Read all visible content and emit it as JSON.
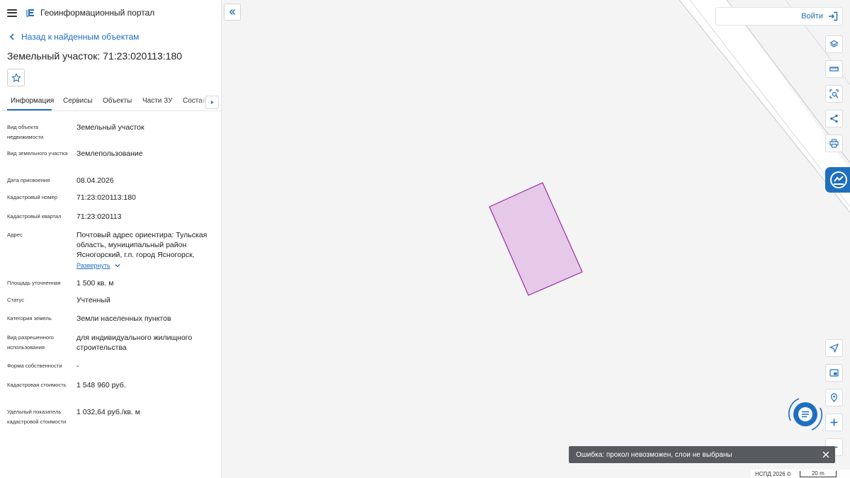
{
  "app": {
    "title": "Геоинформационный портал"
  },
  "nav": {
    "back_label": "Назад к найденным объектам"
  },
  "object": {
    "title": "Земельный участок: 71:23:020113:180"
  },
  "tabs": [
    {
      "label": "Информация"
    },
    {
      "label": "Сервисы"
    },
    {
      "label": "Объекты"
    },
    {
      "label": "Части ЗУ"
    },
    {
      "label": "Состав"
    }
  ],
  "fields": [
    {
      "label": "Вид объекта недвижимости",
      "value": "Земельный участок"
    },
    {
      "label": "Вид земельного участка",
      "value": "Землепользование"
    },
    {
      "label": "Дата присвоения",
      "value": "08.04.2026"
    },
    {
      "label": "Кадастровый номер",
      "value": "71:23:020113:180"
    },
    {
      "label": "Кадастровый квартал",
      "value": "71:23:020113"
    },
    {
      "label": "Адрес",
      "value": "Почтовый адрес ориентира: Тульская область, муниципальный район Ясногорский, г.п. город Ясногорск,",
      "expand_label": "Развернуть"
    },
    {
      "label": "Площадь уточненная",
      "value": "1 500 кв. м"
    },
    {
      "label": "Статус",
      "value": "Учтенный"
    },
    {
      "label": "Категория земель",
      "value": "Земли населенных пунктов"
    },
    {
      "label": "Вид разрешенного использования",
      "value": "для индивидуального жилищного строительства"
    },
    {
      "label": "Форма собственности",
      "value": "-"
    },
    {
      "label": "Кадастровая стоимость",
      "value": "1 548 960 руб."
    },
    {
      "label": "Удельный показатель кадастровой стоимости",
      "value": "1 032,64 руб./кв. м"
    }
  ],
  "header": {
    "login_label": "Войти"
  },
  "toolbar": {
    "icons": [
      "layers-icon",
      "ruler-icon",
      "select-area-icon",
      "share-icon",
      "print-icon"
    ],
    "bottom_icons": [
      "geolocation-icon",
      "minimap-icon",
      "location-pin-icon",
      "zoom-in-icon",
      "zoom-out-icon"
    ]
  },
  "toast": {
    "message": "Ошибка: прокол невозможен, слои не выбраны"
  },
  "footer": {
    "copyright": "НСПД 2026 ©",
    "scale_label": "20 m"
  },
  "colors": {
    "accent": "#1f6fbf",
    "parcel_fill": "#e6c8e8",
    "parcel_stroke": "#9b2ea3",
    "toast_bg": "#575a5e"
  }
}
